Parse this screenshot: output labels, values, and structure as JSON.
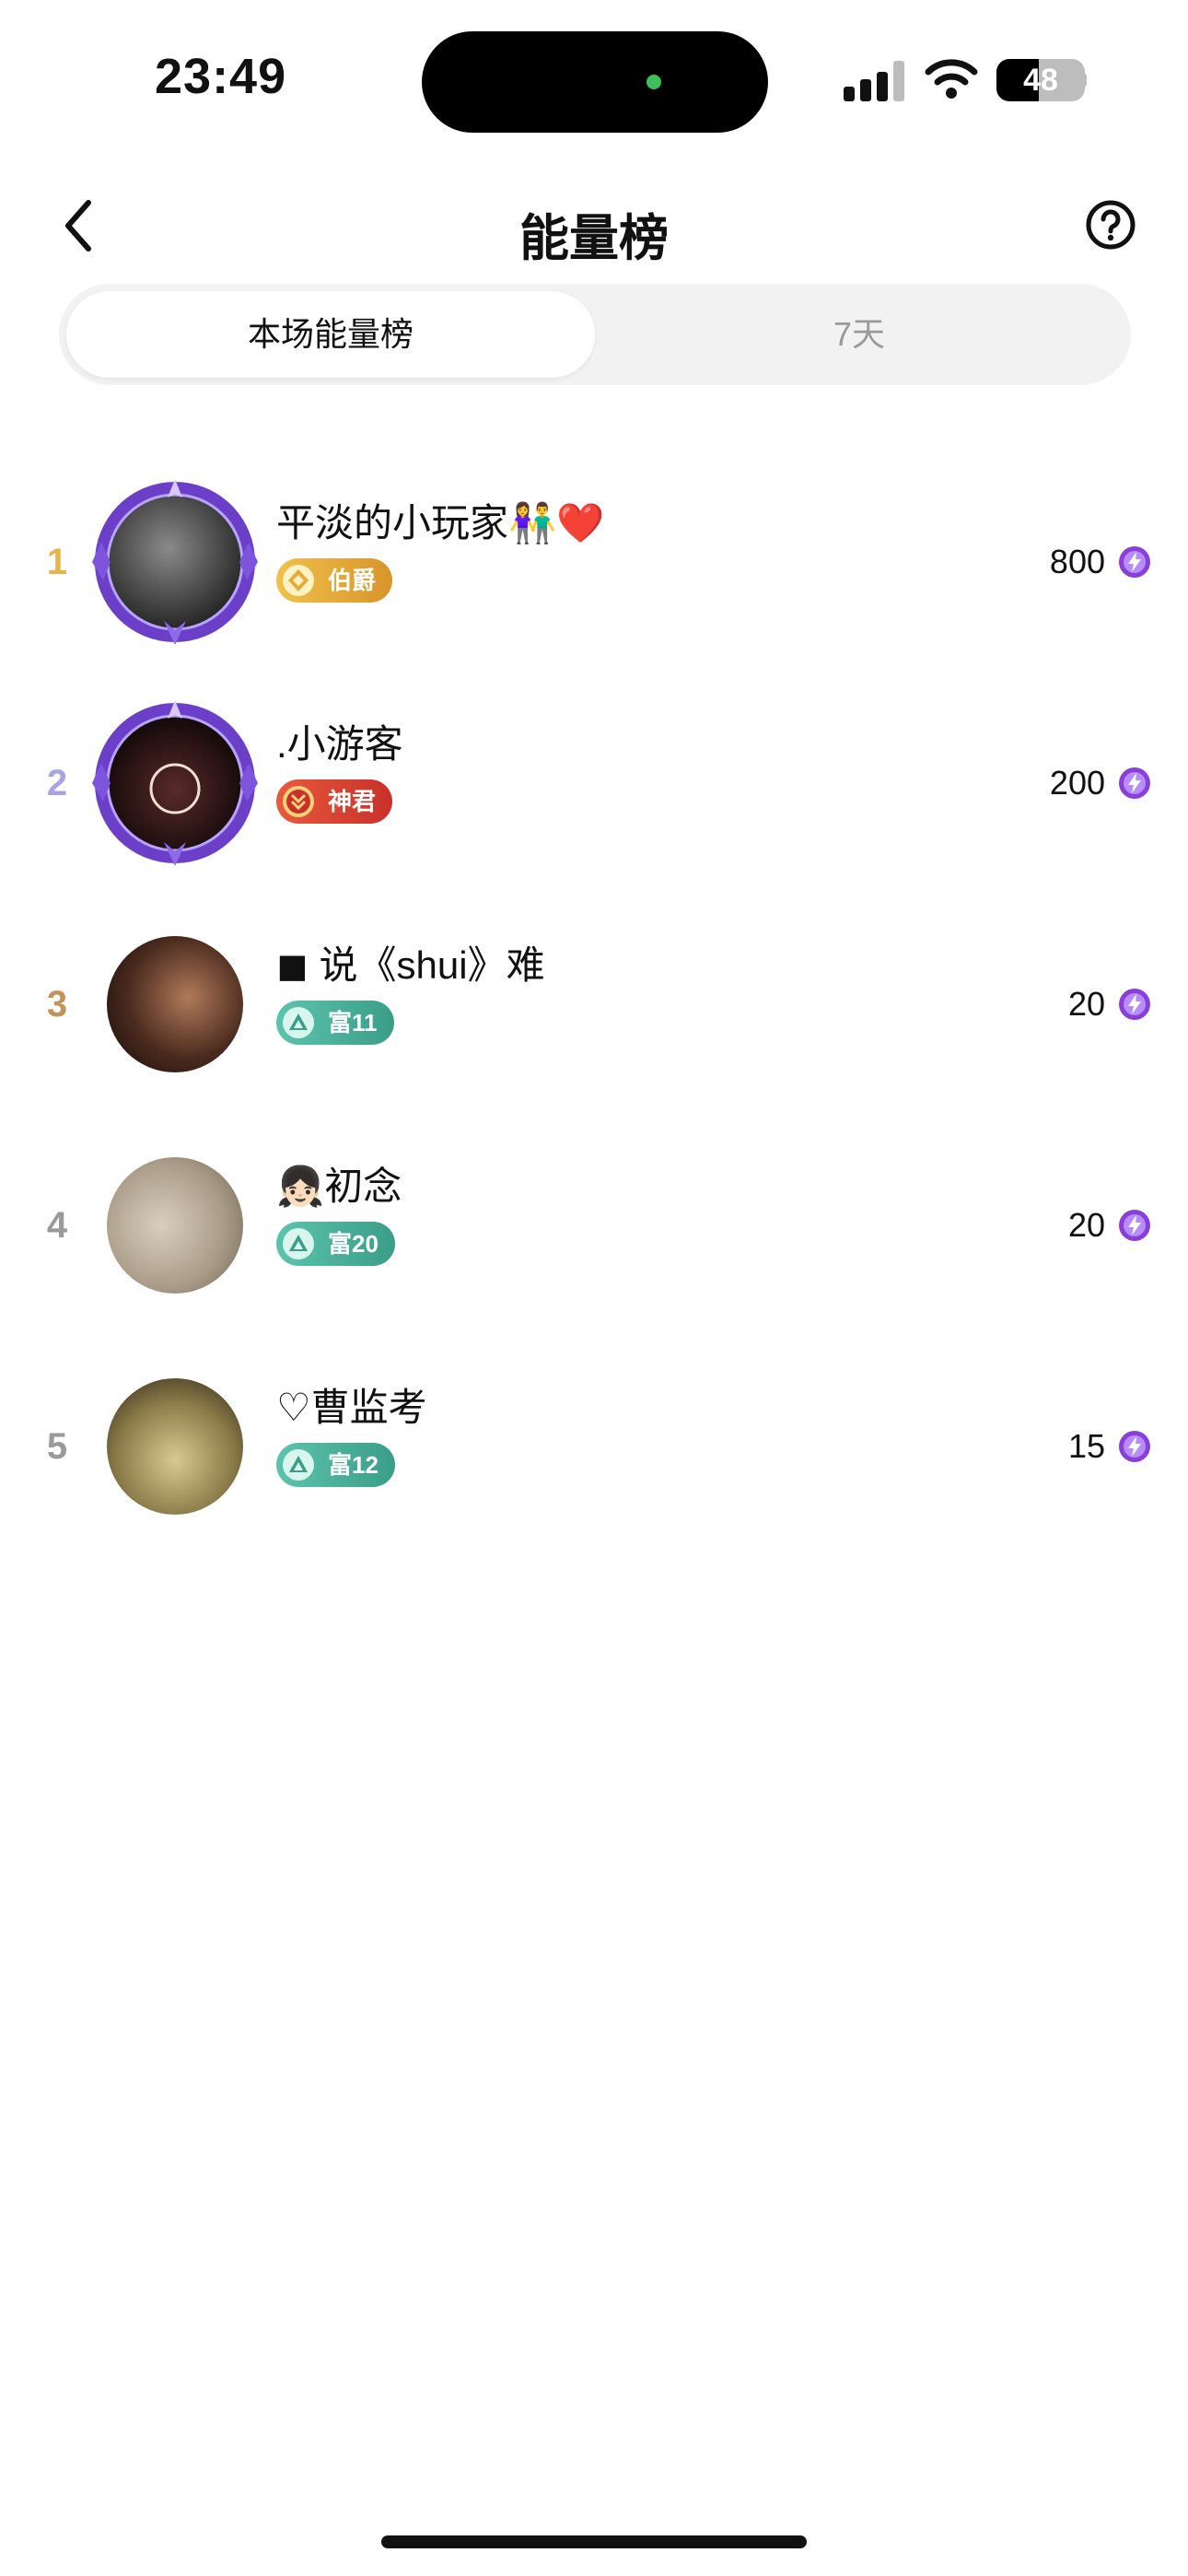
{
  "status_bar": {
    "time": "23:49",
    "battery": "48"
  },
  "header": {
    "title": "能量榜"
  },
  "tabs": [
    {
      "label": "本场能量榜",
      "active": true
    },
    {
      "label": "7天",
      "active": false
    }
  ],
  "ranking": [
    {
      "rank": "1",
      "name": "平淡的小玩家👫❤️",
      "badge": "伯爵",
      "score": "800"
    },
    {
      "rank": "2",
      "name": ".小游客",
      "badge": "神君",
      "score": "200"
    },
    {
      "rank": "3",
      "name": "◼ 说《shui》难",
      "badge": "富11",
      "score": "20"
    },
    {
      "rank": "4",
      "name": "👧🏻初念",
      "badge": "富20",
      "score": "20"
    },
    {
      "rank": "5",
      "name": "♡曹监考",
      "badge": "富12",
      "score": "15"
    }
  ],
  "colors": {
    "rank_1": "#e8b54a",
    "rank_2": "#a9a3e6",
    "rank_3": "#c49358",
    "rank_other": "#9a9a9a",
    "badge_gold": "#e6a93a",
    "badge_red": "#e04436",
    "badge_teal": "#4fb7a0",
    "energy": "#8b3fd9"
  },
  "icons": [
    "back-icon",
    "help-icon",
    "energy-icon",
    "crest-icon",
    "chevron-icon",
    "triangle-icon"
  ]
}
